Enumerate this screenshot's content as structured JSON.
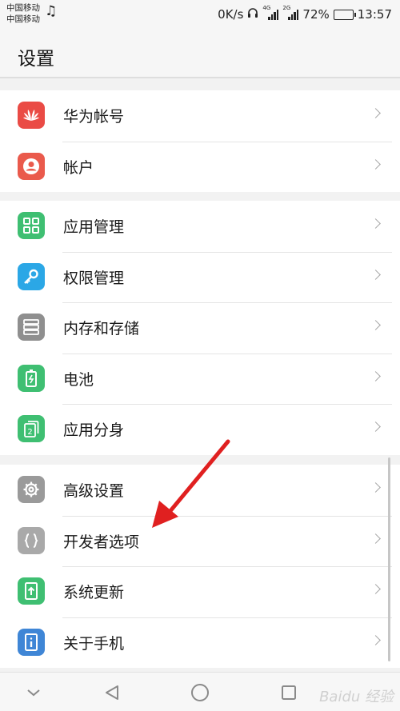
{
  "status_bar": {
    "carrier_1": "中国移动",
    "carrier_2": "中国移动",
    "net_speed": "0K/s",
    "sim1_tag": "4G",
    "sim2_tag": "2G",
    "battery_percent": "72%",
    "battery_level": 0.72,
    "time": "13:57"
  },
  "header": {
    "title": "设置"
  },
  "groups": [
    {
      "items": [
        {
          "label": "华为帐号",
          "icon": "huawei-logo-icon",
          "color": "#ea4b45"
        },
        {
          "label": "帐户",
          "icon": "account-icon",
          "color": "#ea5a4c"
        }
      ]
    },
    {
      "items": [
        {
          "label": "应用管理",
          "icon": "apps-grid-icon",
          "color": "#3fbf72"
        },
        {
          "label": "权限管理",
          "icon": "key-icon",
          "color": "#2ba7e6"
        },
        {
          "label": "内存和存储",
          "icon": "storage-icon",
          "color": "#8f8f8f"
        },
        {
          "label": "电池",
          "icon": "battery-icon",
          "color": "#3fbf72"
        },
        {
          "label": "应用分身",
          "icon": "app-twin-icon",
          "color": "#3fbf72"
        }
      ]
    },
    {
      "items": [
        {
          "label": "高级设置",
          "icon": "gear-icon",
          "color": "#9a9a9a"
        },
        {
          "label": "开发者选项",
          "icon": "braces-icon",
          "color": "#a9a9a9"
        },
        {
          "label": "系统更新",
          "icon": "update-icon",
          "color": "#3fbf72"
        },
        {
          "label": "关于手机",
          "icon": "info-icon",
          "color": "#3f86d6"
        }
      ]
    }
  ],
  "nav_bar": {
    "hide": "chevron-down-icon",
    "back": "back-triangle-icon",
    "home": "home-circle-icon",
    "recents": "recents-square-icon"
  },
  "watermark": "Baidu 经验"
}
